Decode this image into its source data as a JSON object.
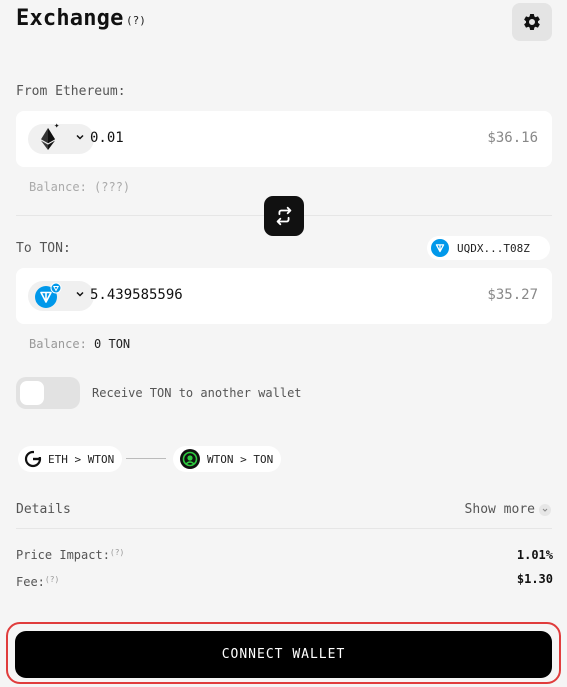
{
  "header": {
    "title": "Exchange",
    "help_mark": "(?)"
  },
  "from": {
    "label": "From Ethereum:",
    "amount": "0.01",
    "usd_value": "$36.16",
    "balance": "Balance: (???)",
    "token_icon": "ethereum-icon"
  },
  "to": {
    "label": "To TON:",
    "wallet_address": "UQDX...T08Z",
    "amount": "5.439585596",
    "usd_value": "$35.27",
    "balance_label": "Balance:",
    "balance_value": "0 TON",
    "token_icon": "ton-icon"
  },
  "toggle": {
    "label": "Receive TON to another wallet",
    "on": false
  },
  "route": {
    "step1": "ETH > WTON",
    "step2": "WTON > TON"
  },
  "details": {
    "title": "Details",
    "show_more": "Show more",
    "price_impact_label": "Price Impact:",
    "price_impact_help": "(?)",
    "price_impact_value": "1.01%",
    "fee_label": "Fee:",
    "fee_help": "(?)",
    "fee_value": "$1.30"
  },
  "action": {
    "connect_label": "CONNECT WALLET"
  },
  "colors": {
    "background": "#f5f5f5",
    "ton_blue": "#0098ea",
    "button_black": "#000000",
    "highlight_red": "#e03c3c",
    "route_green": "#2ecc40"
  }
}
